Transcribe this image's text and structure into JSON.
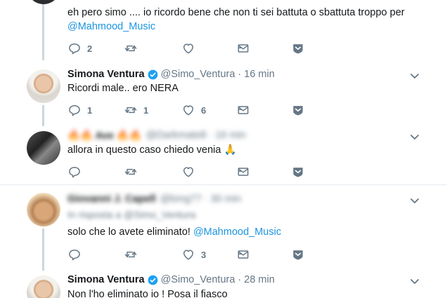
{
  "tweets": [
    {
      "text": "eh pero simo .... io ricordo bene che non ti sei battuta o sbattuta troppo per",
      "mention": "@Mahmood_Music",
      "reply_count": "2",
      "retweet_count": "",
      "like_count": ""
    },
    {
      "name": "Simona Ventura",
      "handle": "@Simo_Ventura",
      "dot": "·",
      "time": "16 min",
      "text": "Ricordi male.. ero NERA",
      "reply_count": "1",
      "retweet_count": "1",
      "like_count": "6"
    },
    {
      "name": "🔥🔥 Ave 🔥🔥",
      "handle": "@Darkmate8",
      "dot": "·",
      "time": "16 min",
      "text": "allora in questo caso chiedo venia 🙏",
      "reply_count": "",
      "retweet_count": "",
      "like_count": ""
    },
    {
      "name": "Giovanni J. Capell",
      "handle": "@bmg77",
      "dot": "·",
      "time": "30 min",
      "reply_to": "In risposta a @Simo_Ventura",
      "text": "solo che lo avete eliminato!",
      "mention": "@Mahmood_Music",
      "reply_count": "",
      "retweet_count": "",
      "like_count": "3"
    },
    {
      "name": "Simona Ventura",
      "handle": "@Simo_Ventura",
      "dot": "·",
      "time": "28 min",
      "text": "Non l'ho eliminato io ! Posa il fiasco"
    }
  ],
  "icons": {
    "reply": "reply-icon",
    "retweet": "retweet-icon",
    "like": "heart-icon",
    "dm": "envelope-icon",
    "ios": "chevron-badge-icon",
    "menu": "chevron-down-icon",
    "verified": "verified-badge-icon"
  },
  "colors": {
    "accent": "#1b95e0",
    "muted": "#657786",
    "verified": "#1da1f2",
    "separator": "#e6ecf0"
  }
}
